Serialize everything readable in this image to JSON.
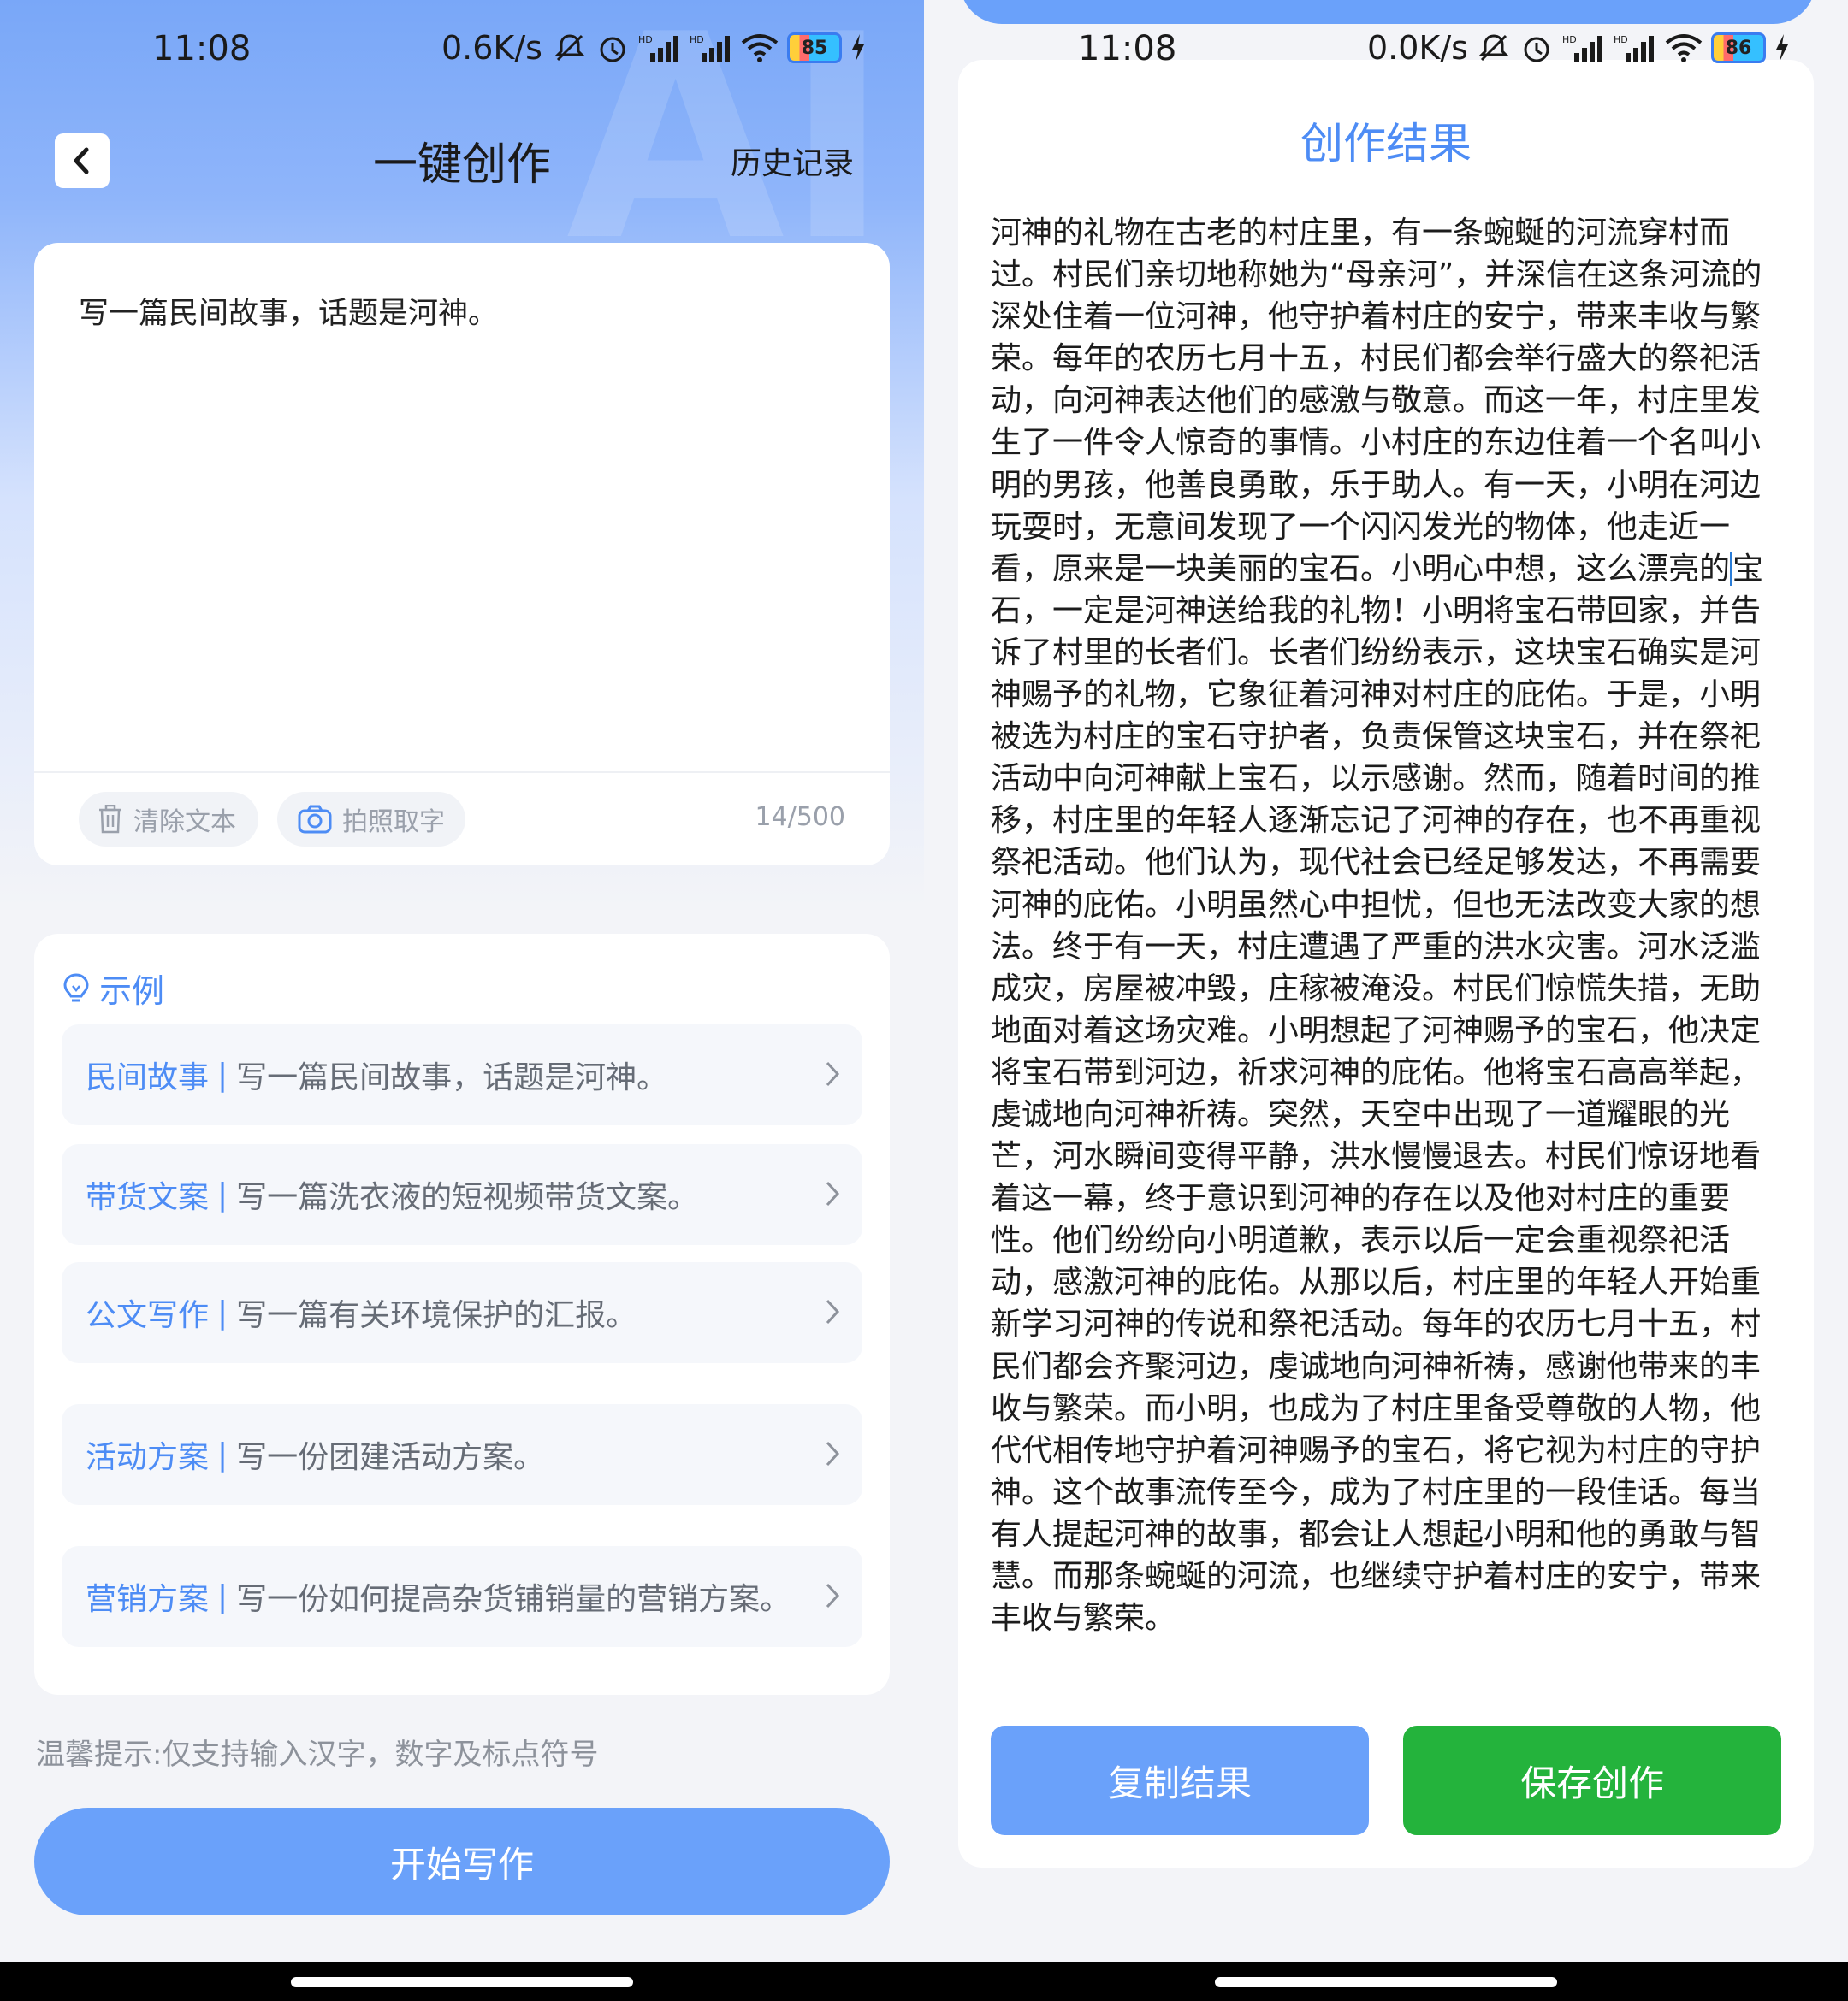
{
  "left": {
    "status": {
      "time": "11:08",
      "net_speed": "0.6K/s",
      "battery": "85"
    },
    "watermark": "AI",
    "nav": {
      "title": "一键创作",
      "history": "历史记录"
    },
    "input": {
      "text": "写一篇民间故事，话题是河神。",
      "clear": "清除文本",
      "photo": "拍照取字",
      "counter": "14/500"
    },
    "examples": {
      "title": "示例",
      "items": [
        {
          "cat": "民间故事",
          "sep": "|",
          "desc": "写一篇民间故事，话题是河神。"
        },
        {
          "cat": "带货文案",
          "sep": "|",
          "desc": "写一篇洗衣液的短视频带货文案。"
        },
        {
          "cat": "公文写作",
          "sep": "|",
          "desc": "写一篇有关环境保护的汇报。"
        },
        {
          "cat": "活动方案",
          "sep": "|",
          "desc": "写一份团建活动方案。"
        },
        {
          "cat": "营销方案",
          "sep": "|",
          "desc": "写一份如何提高杂货铺销量的营销方案。"
        }
      ]
    },
    "tip": "温馨提示:仅支持输入汉字，数字及标点符号",
    "start": "开始写作"
  },
  "right": {
    "status": {
      "time": "11:08",
      "net_speed": "0.0K/s",
      "battery": "86"
    },
    "title": "创作结果",
    "text_before_cursor": "河神的礼物在古老的村庄里，有一条蜿蜒的河流穿村而过。村民们亲切地称她为“母亲河”，并深信在这条河流的深处住着一位河神，他守护着村庄的安宁，带来丰收与繁荣。每年的农历七月十五，村民们都会举行盛大的祭祀活动，向河神表达他们的感激与敬意。而这一年，村庄里发生了一件令人惊奇的事情。小村庄的东边住着一个名叫小明的男孩，他善良勇敢，乐于助人。有一天，小明在河边玩耍时，无意间发现了一个闪闪发光的物体，他走近一看，原来是一块美丽的宝石。小明心中想，这么漂亮的",
    "text_after_cursor": "宝石，一定是河神送给我的礼物！小明将宝石带回家，并告诉了村里的长者们。长者们纷纷表示，这块宝石确实是河神赐予的礼物，它象征着河神对村庄的庇佑。于是，小明被选为村庄的宝石守护者，负责保管这块宝石，并在祭祀活动中向河神献上宝石，以示感谢。然而，随着时间的推移，村庄里的年轻人逐渐忘记了河神的存在，也不再重视祭祀活动。他们认为，现代社会已经足够发达，不再需要河神的庇佑。小明虽然心中担忧，但也无法改变大家的想法。终于有一天，村庄遭遇了严重的洪水灾害。河水泛滥成灾，房屋被冲毁，庄稼被淹没。村民们惊慌失措，无助地面对着这场灾难。小明想起了河神赐予的宝石，他决定将宝石带到河边，祈求河神的庇佑。他将宝石高高举起，虔诚地向河神祈祷。突然，天空中出现了一道耀眼的光芒，河水瞬间变得平静，洪水慢慢退去。村民们惊讶地看着这一幕，终于意识到河神的存在以及他对村庄的重要性。他们纷纷向小明道歉，表示以后一定会重视祭祀活动，感激河神的庇佑。从那以后，村庄里的年轻人开始重新学习河神的传说和祭祀活动。每年的农历七月十五，村民们都会齐聚河边，虔诚地向河神祈祷，感谢他带来的丰收与繁荣。而小明，也成为了村庄里备受尊敬的人物，他代代相传地守护着河神赐予的宝石，将它视为村庄的守护神。这个故事流传至今，成为了村庄里的一段佳话。每当有人提起河神的故事，都会让人想起小明和他的勇敢与智慧。而那条蜿蜒的河流，也继续守护着村庄的安宁，带来丰收与繁荣。",
    "copy": "复制结果",
    "save": "保存创作"
  },
  "icons": [
    "back-icon",
    "chevron-right-icon",
    "trash-icon",
    "camera-icon",
    "lightbulb-icon",
    "wifi-icon",
    "signal-icon",
    "alarm-icon",
    "mute-icon",
    "charging-icon"
  ],
  "colors": {
    "accent": "#4d8cf5",
    "button_blue": "#6aa1fa",
    "button_green": "#24b33c"
  }
}
